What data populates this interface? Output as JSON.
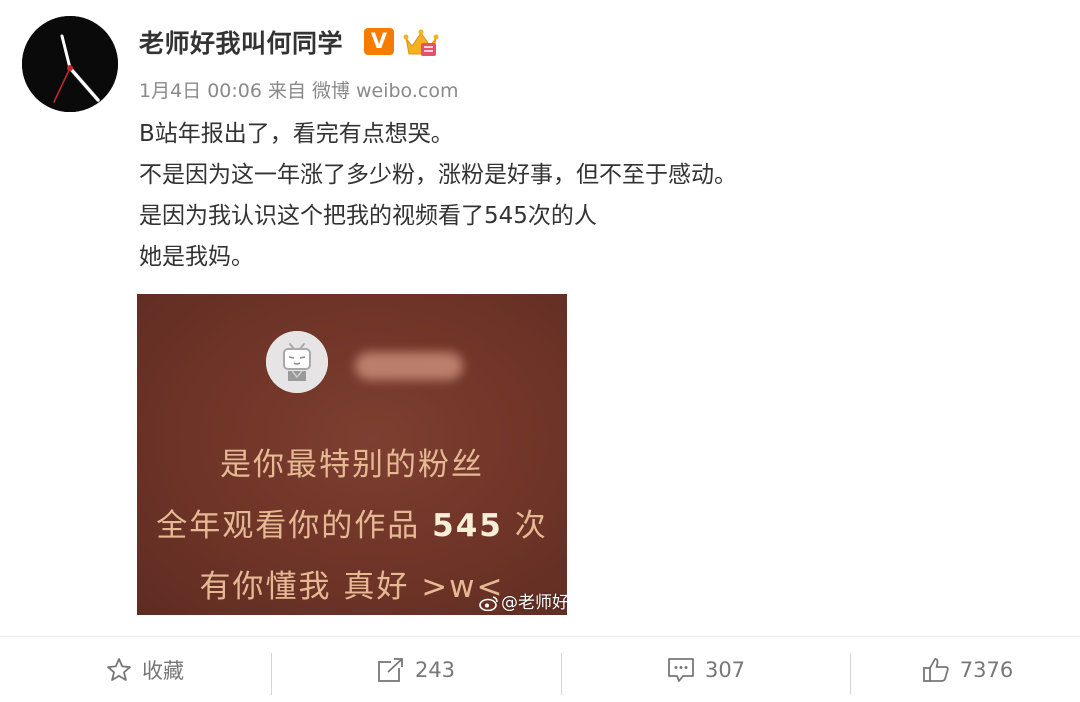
{
  "author": {
    "name": "老师好我叫何同学",
    "verified_badge": "V"
  },
  "meta": {
    "date": "1月4日",
    "time": "00:06",
    "source_prefix": "来自",
    "source_app": "微博",
    "source_site": "weibo.com"
  },
  "content": {
    "lines": [
      "B站年报出了，看完有点想哭。",
      "不是因为这一年涨了多少粉，涨粉是好事，但不至于感动。",
      "是因为我认识这个把我的视频看了545次的人",
      "她是我妈。"
    ]
  },
  "image": {
    "line1": "是你最特别的粉丝",
    "line2_prefix": "全年观看你的作品",
    "line2_number": "545",
    "line2_suffix": "次",
    "line3": "有你懂我 真好 >w<",
    "watermark": "@老师好"
  },
  "actions": {
    "favorite_label": "收藏",
    "share_count": "243",
    "comment_count": "307",
    "like_count": "7376"
  },
  "colors": {
    "badge_orange": "#f57c00",
    "image_background": "#6e3427",
    "image_text": "#e6b994"
  },
  "icons": [
    "star-icon",
    "share-icon",
    "comment-icon",
    "like-icon",
    "weibo-logo-icon",
    "crown-badge-icon",
    "bilibili-tv-icon"
  ]
}
